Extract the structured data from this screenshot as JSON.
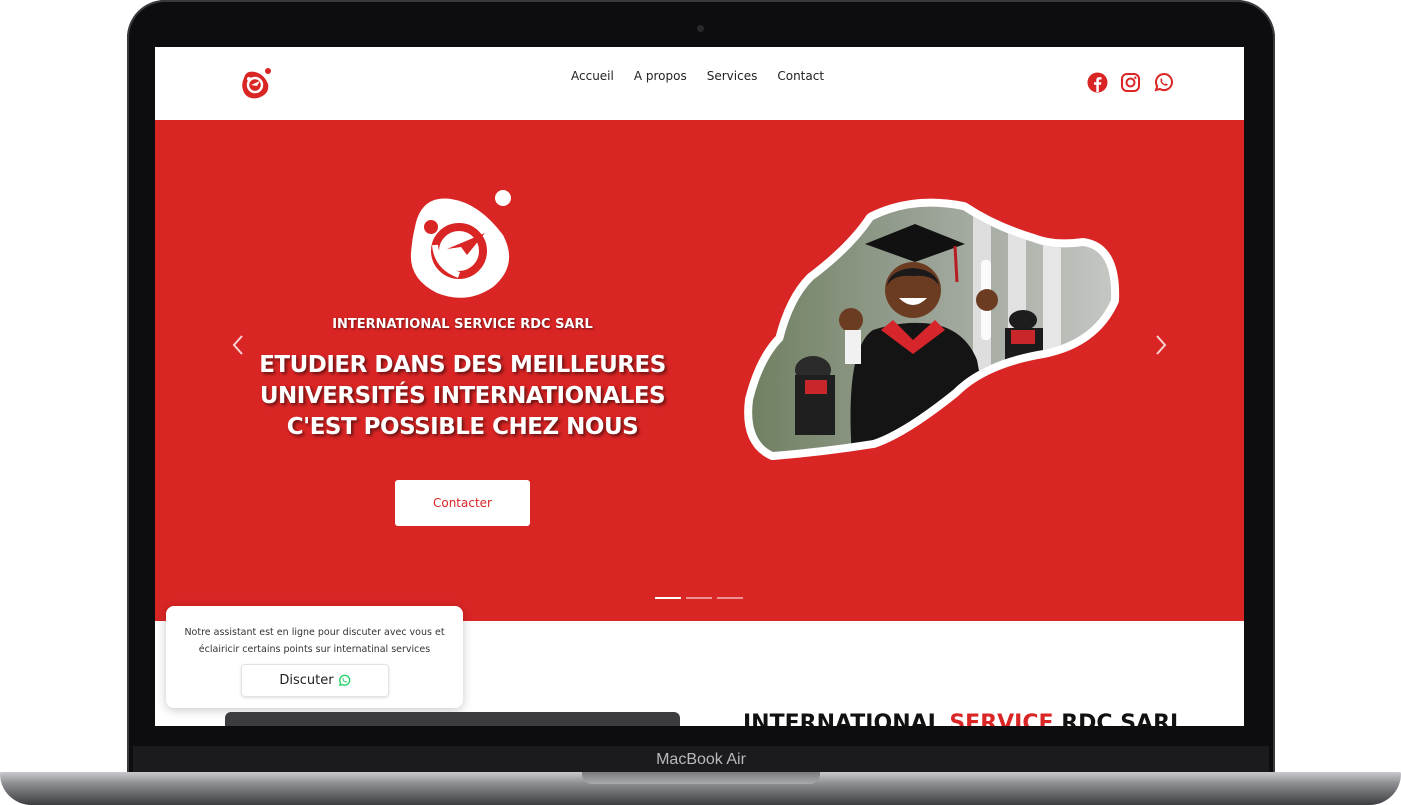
{
  "device": {
    "label": "MacBook Air"
  },
  "header": {
    "nav": [
      {
        "label": "Accueil"
      },
      {
        "label": "A propos"
      },
      {
        "label": "Services"
      },
      {
        "label": "Contact"
      }
    ],
    "socials": [
      "facebook-icon",
      "instagram-icon",
      "whatsapp-icon"
    ]
  },
  "hero": {
    "company": "INTERNATIONAL SERVICE RDC SARL",
    "title_line1": "ETUDIER DANS DES MEILLEURES",
    "title_line2": "UNIVERSITÉS INTERNATIONALES",
    "title_line3": "C'EST POSSIBLE CHEZ NOUS",
    "cta_label": "Contacter",
    "slides_count": 3,
    "active_slide": 1
  },
  "chat": {
    "message": "Notre assistant est en ligne pour discuter avec vous et éclairicir certains points sur internatinal services",
    "button_label": "Discuter"
  },
  "about": {
    "title_part1": "INTERNATIONAL ",
    "title_accent": "SERVICE",
    "title_part2": " RDC SARL"
  },
  "colors": {
    "brand_red": "#da2525",
    "whatsapp_green": "#25d366"
  }
}
